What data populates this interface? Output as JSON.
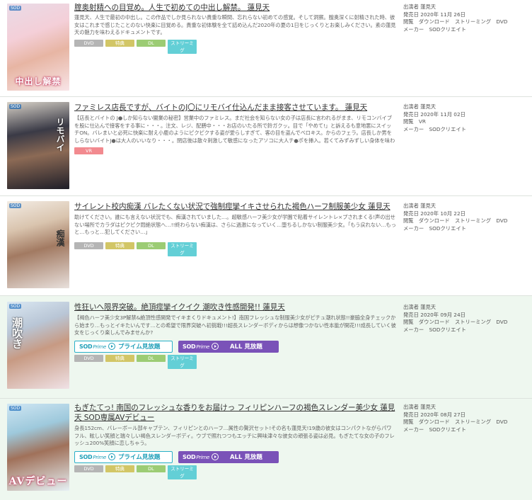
{
  "meta_labels": {
    "performer": "出演者",
    "release": "発売日",
    "view": "閲覧",
    "maker": "メーカー"
  },
  "tags": {
    "dvd": "DVD",
    "tokuten": "特典",
    "dl": "DL",
    "streaming": "ストリーミ\nグ",
    "vr": "VR"
  },
  "banners": {
    "prime": "プライム見放題",
    "all": "ALL 見放題",
    "logo": "SOD",
    "logo_sub": "Prime"
  },
  "items": [
    {
      "title": "腟奥射精への目覚め。人生で初めての中出し解禁。 蓮見天",
      "desc": "蓮見天、人生で最初の中出し。この作品でしか見られない貴重な瞬間、忘れらない初めての感覚。そして洞察。膣奥深くに射精された時、彼女はこれまで感じたことのない快楽に目覚める。貴重な初体験を全て詰め込んだ2020年の夏の1日をじっくりとお楽しみください。素の蓮見天の魅力を味わえるドキュメントです。",
      "thumb_caption": "中出し解禁",
      "performer": "蓮見天",
      "release": "2020年 11月 26日",
      "view": "ダウンロード　ストリーミング　DVD",
      "maker": "SODクリエイト"
    },
    {
      "title": "ファミレス店長ですが、バイトのJ〇にリモバイ仕込んだまま接客させています。 蓮見天",
      "desc": "【店長とバイトの J●しか知らない闇業の秘密】営業中のファミレス。まだ社会を知らない女の子は店長に言われるがまま、リモコンバイブを股に仕込んで接客をする事に・・・。注文、レジ、配膳中・・・お店のいたる所で鈴ガクッ。目で「やめて!」と訴えるも意地悪にスイッチON。バレまいと必死に快楽に耐え小鹿のようにピクピクする姿が愛らしすぎて、客の目を盗んでベロキス。からのフェラ。店長しか男をしらないバイトJ●は大人のいいなり・・・。閉店後は散々刺激して敏感になったアソコに大人チ●ポを挿入。若くてみずみずしい身体を味わい尽くす。",
      "thumb_caption": "リモバイ",
      "performer": "蓮見天",
      "release": "2020年 11月 02日",
      "view": "VR",
      "maker": "SODクリエイト"
    },
    {
      "title": "サイレント校内痴漢 バレたくない状況で強制痙攣イキさせられた褐色ハーフ制服美少女 蓮見天",
      "desc": "助けてください。誰にも言えない状況でも、痴漢されていました…。超敏感ハーフ美少女が学園で粘着サイレントレ×プされまくる!声の出せない場所でカラダはピクピク悶絶状態へ…!!終わらない痴漢は、さらに過激になっていく…堕ちるしかない制服美少女。「もう戻れない…もっと…もっと…犯してください…」",
      "thumb_caption": "痴漢",
      "performer": "蓮見天",
      "release": "2020年 10月 22日",
      "view": "ダウンロード　ストリーミング　DVD",
      "maker": "SODクリエイト"
    },
    {
      "title": "性狂いへ限界突破。絶頂痙攣イクイク 潮吹き性感開発!! 蓮見天",
      "desc": "【褐色ハーフ美少女3P解禁&絶頂性感開発でイキまくりドキュメント!】南国フレッシュな制服美少女がピチュ潮れ状態!!豪脇全身チェックから始まり…もっとイキたいんです…との希望で限界突破へ初挑戦!!!超長スレンダーボディからは想像つかない性本能が開花!!!成長していく彼女をじっくり楽しんでみませんか?",
      "thumb_caption": "潮吹き",
      "performer": "蓮見天",
      "release": "2020年 09月 24日",
      "view": "ダウンロード　ストリーミング　DVD",
      "maker": "SODクリエイト"
    },
    {
      "title": "もぎたてっ! 南国のフレッシュな香りをお届けっ フィリピンハーフの褐色スレンダー美少女 蓮見天 SOD専属AVデビュー",
      "desc": "身長152cm、バレーボール部キャプテン、フィリピンとのハーフ…属性の贅沢セット!その名も蓮見天!19歳の彼女はコンパクトながらパワフル、眩しい笑顔と瑞々しい褐色スレンダーボディ。ウブで照れつつもエッチに興味津々な彼女の頑張る姿は必見。もぎたてな女の子のフレッシュ200%笑顔に恋しちゃう。",
      "thumb_caption": "AVデビュー",
      "performer": "蓮見天",
      "release": "2020年 08月 27日",
      "view": "ダウンロード　ストリーミング　DVD",
      "maker": "SODクリエイト"
    }
  ]
}
